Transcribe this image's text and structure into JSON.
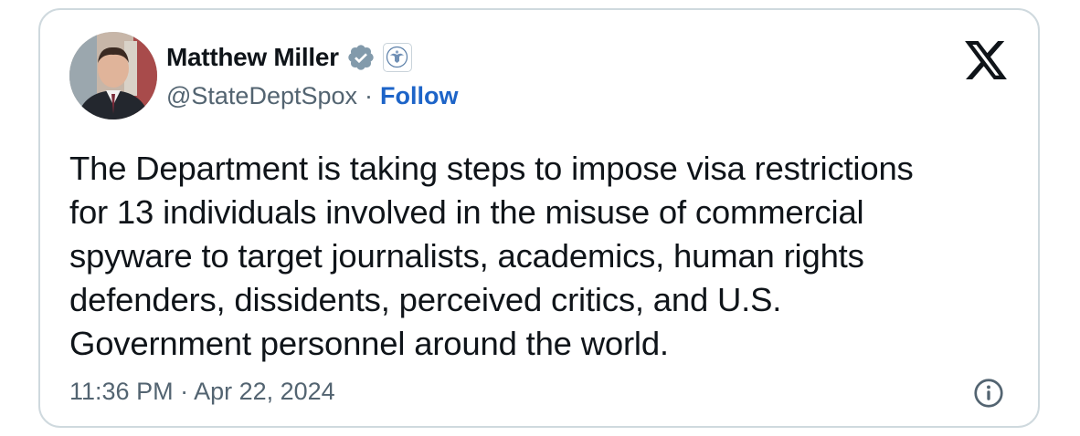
{
  "author": {
    "display_name": "Matthew Miller",
    "handle": "@StateDeptSpox",
    "separator": "·",
    "follow_label": "Follow"
  },
  "tweet": {
    "text_lines": [
      "The Department is taking steps to impose visa restrictions",
      "for 13 individuals involved in the misuse of commercial",
      "spyware to target journalists, academics, human rights",
      "defenders, dissidents, perceived critics, and U.S.",
      "Government personnel around the world."
    ],
    "timestamp": "11:36 PM · Apr 22, 2024"
  },
  "icons": {
    "verified": "verified-badge-icon",
    "affiliation": "state-department-seal-icon",
    "brand": "x-logo-icon",
    "info": "info-icon"
  },
  "colors": {
    "text": "#0f1419",
    "secondary": "#536471",
    "link": "#1d64c8",
    "verified_badge": "#829aab",
    "border": "#cfd9de"
  }
}
